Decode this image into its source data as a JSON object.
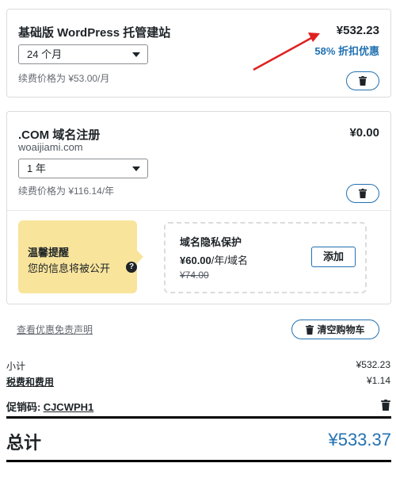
{
  "hosting": {
    "title": "基础版 WordPress 托管建站",
    "price": "¥532.23",
    "discount": "58% 折扣优惠",
    "term_select": "24 个月",
    "renewal": "续费价格为 ¥53.00/月"
  },
  "domain": {
    "title": ".COM 域名注册",
    "domain_name": "woaijiami.com",
    "price": "¥0.00",
    "term_select": "1 年",
    "renewal": "续费价格为 ¥116.14/年"
  },
  "notice": {
    "title": "温馨提醒",
    "text": "您的信息将被公开",
    "help": "?"
  },
  "privacy_upsell": {
    "title": "域名隐私保护",
    "price": "¥60.00",
    "price_unit": "/年/域名",
    "old_price": "¥74.00",
    "add_label": "添加"
  },
  "cart_actions": {
    "disclaimer_link": "查看优惠免责声明",
    "clear_cart_label": "清空购物车"
  },
  "summary": {
    "subtotal_label": "小计",
    "subtotal_value": "¥532.23",
    "taxes_label": "税费和费用",
    "taxes_value": "¥1.14",
    "promo_label": "促销码:",
    "promo_code": "CJCWPH1",
    "total_label": "总计",
    "total_value": "¥533.37"
  },
  "colors": {
    "accent": "#2271b1",
    "notice_bg": "#f9e49c",
    "arrow": "#e02020"
  },
  "icons": [
    "trash-icon",
    "help-icon",
    "chevron-down-icon"
  ]
}
